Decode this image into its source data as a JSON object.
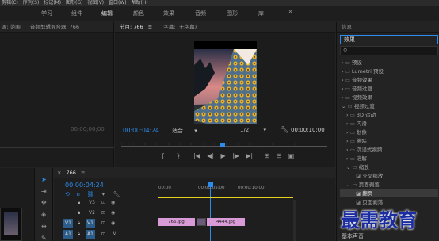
{
  "menubar": {
    "items": [
      "剪辑(C)",
      "序列(S)",
      "标记(M)",
      "图形(G)",
      "视图(V)",
      "窗口(W)",
      "帮助(H)"
    ]
  },
  "workspaces": {
    "items": [
      "学习",
      "组件",
      "编辑",
      "颜色",
      "效果",
      "音频",
      "图形",
      "库"
    ],
    "active_index": 2,
    "more_icon": "double-chevron-right-icon"
  },
  "source_panel": {
    "title": "源: 范围",
    "mixer_tab": "音频剪辑混合器: 766",
    "timecode": "00;00;00;00"
  },
  "program": {
    "title": "节目: 766",
    "title2": "字幕: (无字幕)",
    "timecode": "00:00:04:24",
    "fit": "适合",
    "resolution": "1/2",
    "duration": "00:00:10:00"
  },
  "info_tab": "信息",
  "effects": {
    "title": "效果",
    "search_placeholder": "",
    "items": [
      {
        "label": "预设",
        "level": 0,
        "expanded": false
      },
      {
        "label": "Lumetri 预设",
        "level": 0,
        "expanded": false
      },
      {
        "label": "音频效果",
        "level": 0,
        "expanded": false
      },
      {
        "label": "音频过渡",
        "level": 0,
        "expanded": false
      },
      {
        "label": "视频效果",
        "level": 0,
        "expanded": false
      },
      {
        "label": "视频过渡",
        "level": 0,
        "expanded": true
      },
      {
        "label": "3D 运动",
        "level": 1,
        "expanded": false
      },
      {
        "label": "内滑",
        "level": 1,
        "expanded": false
      },
      {
        "label": "划像",
        "level": 1,
        "expanded": false
      },
      {
        "label": "擦除",
        "level": 1,
        "expanded": false
      },
      {
        "label": "沉浸式视频",
        "level": 1,
        "expanded": false
      },
      {
        "label": "溶解",
        "level": 1,
        "expanded": false
      },
      {
        "label": "缩放",
        "level": 1,
        "expanded": true
      },
      {
        "label": "交叉缩放",
        "level": 2,
        "expanded": false
      },
      {
        "label": "页面剥落",
        "level": 1,
        "expanded": true
      },
      {
        "label": "翻页",
        "level": 2,
        "expanded": false,
        "selected": true
      },
      {
        "label": "页面剥落",
        "level": 2,
        "expanded": false
      }
    ],
    "bottom_label": "基本声音"
  },
  "timeline": {
    "title": "766",
    "timecode": "00:00:04:24",
    "ruler": [
      "00:00",
      "00:00:05:00",
      "00:00:10:00"
    ],
    "tracks": [
      {
        "name": "V3",
        "type": "video"
      },
      {
        "name": "V2",
        "type": "video"
      },
      {
        "name": "V1",
        "type": "video",
        "source": "V1"
      },
      {
        "name": "A1",
        "type": "audio",
        "source": "A1",
        "mute": "M"
      }
    ],
    "clips": [
      {
        "label": "766.jpg"
      },
      {
        "label": "4444.jpg"
      }
    ]
  },
  "watermark": "最需教育",
  "colors": {
    "accent": "#2d8ceb",
    "clip": "#d99ad8",
    "timeline_bar": "#e8d31c",
    "background": "#232323"
  }
}
